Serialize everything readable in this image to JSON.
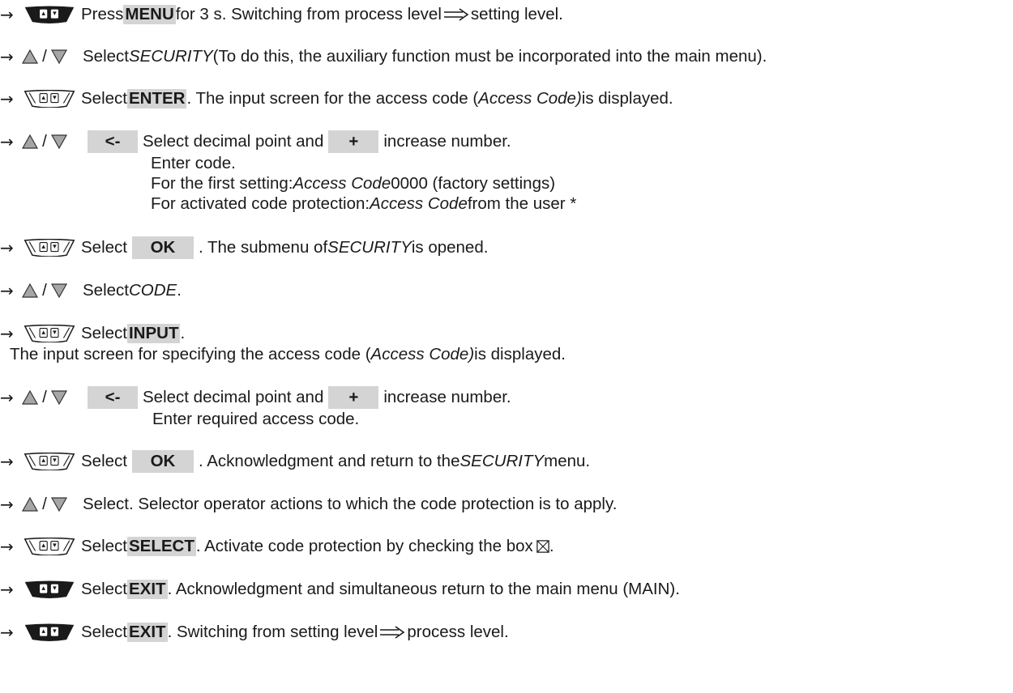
{
  "arrow": "→",
  "slash": "/",
  "icons": {
    "keypad_filled": "keypad-icon (dark)",
    "keypad_outline": "keypad-icon (outline)",
    "up_triangle": "triangle-up-icon",
    "down_triangle": "triangle-down-icon",
    "checkbox": "checked-box-icon",
    "implies": "double-arrow-icon"
  },
  "keys": {
    "lt": "<-",
    "plus": "+",
    "ok": "OK"
  },
  "steps": {
    "s1": {
      "a": " Press ",
      "key": "MENU",
      "b": " for 3 s. Switching from process level ",
      "c": " setting level."
    },
    "s2": {
      "a": " Select ",
      "em": "SECURITY",
      "b": " (To do this, the auxiliary function must be incorporated into the main menu)."
    },
    "s3": {
      "a": " Select ",
      "key": "ENTER",
      "b": ". The input screen for the access code (",
      "em": "Access Code)",
      "c": " is displayed."
    },
    "s4": {
      "a": "Select decimal point and ",
      "b": "increase number.",
      "l2": "Enter code.",
      "l3a": "For the first setting: ",
      "l3em": "Access Code",
      "l3b": " 0000 (factory settings)",
      "l4a": "For activated code protection: ",
      "l4em": "Access Code",
      "l4b": " from the user *"
    },
    "s5": {
      "a": " Select ",
      "b": ". The submenu of ",
      "em": "SECURITY",
      "c": " is opened."
    },
    "s6": {
      "a": " Select ",
      "em": "CODE",
      "b": "."
    },
    "s7": {
      "a": " Select ",
      "key": "INPUT",
      "b": ".",
      "l2a": "The input screen for specifying the access code (",
      "l2em": "Access Code)",
      "l2b": " is displayed."
    },
    "s8": {
      "a": "Select decimal point and ",
      "b": "increase number.",
      "l2": "Enter required access code."
    },
    "s9": {
      "a": " Select ",
      "b": ". Acknowledgment and return to the ",
      "em": "SECURITY",
      "c": " menu."
    },
    "s10": {
      "a": " Select. Selector operator actions to which the code protection is to apply."
    },
    "s11": {
      "a": " Select ",
      "key": "SELECT",
      "b": ". Activate code protection by checking the box "
    },
    "s12": {
      "a": " Select ",
      "key": "EXIT",
      "b": ". Acknowledgment and simultaneous return to the main menu (MAIN)."
    },
    "s13": {
      "a": " Select ",
      "key": "EXIT",
      "b": ". Switching from setting level ",
      "c": " process level."
    }
  }
}
